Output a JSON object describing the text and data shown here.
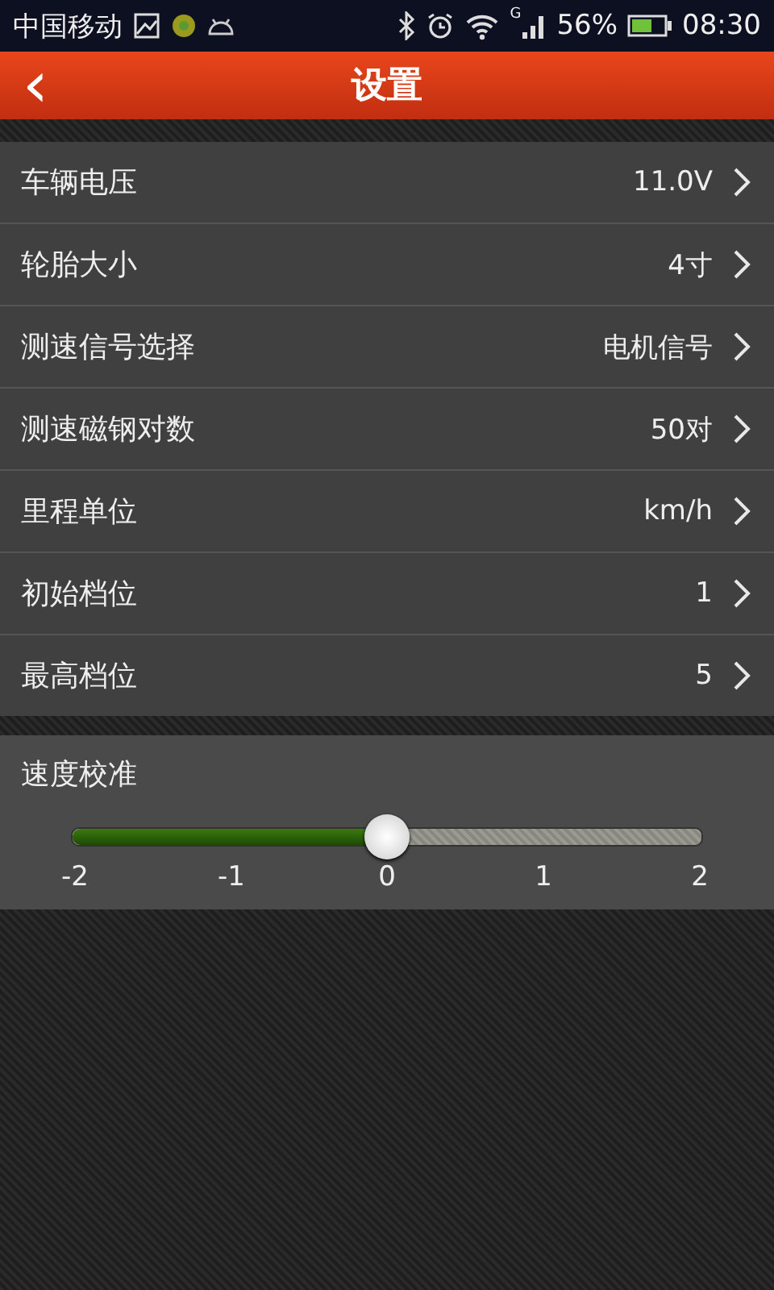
{
  "status_bar": {
    "carrier": "中国移动",
    "signal_type": "G",
    "battery_percent": "56%",
    "time": "08:30"
  },
  "header": {
    "back": "‹",
    "title": "设置"
  },
  "settings": [
    {
      "label": "车辆电压",
      "value": "11.0V"
    },
    {
      "label": "轮胎大小",
      "value": "4寸"
    },
    {
      "label": "测速信号选择",
      "value": "电机信号"
    },
    {
      "label": "测速磁钢对数",
      "value": "50对"
    },
    {
      "label": "里程单位",
      "value": "km/h"
    },
    {
      "label": "初始档位",
      "value": "1"
    },
    {
      "label": "最高档位",
      "value": "5"
    }
  ],
  "calibration": {
    "label": "速度校准",
    "level": 0.5,
    "ticks": [
      "-2",
      "-1",
      "0",
      "1",
      "2"
    ]
  }
}
